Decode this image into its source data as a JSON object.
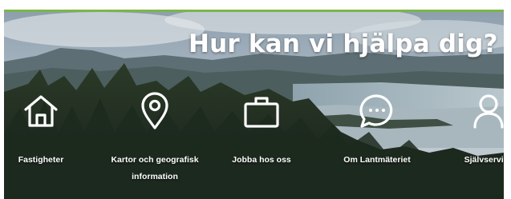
{
  "hero": {
    "headline": "Hur kan vi hjälpa dig?"
  },
  "nav": {
    "items": [
      {
        "label": "Fastigheter",
        "icon": "house-icon"
      },
      {
        "label": "Kartor och geografisk information",
        "icon": "map-pin-icon"
      },
      {
        "label": "Jobba hos oss",
        "icon": "briefcase-icon"
      },
      {
        "label": "Om Lantmäteriet",
        "icon": "chat-bubble-icon"
      },
      {
        "label": "Självservice",
        "icon": "user-icon"
      }
    ]
  },
  "colors": {
    "accent_bar": "#7ab648",
    "text": "#ffffff"
  }
}
